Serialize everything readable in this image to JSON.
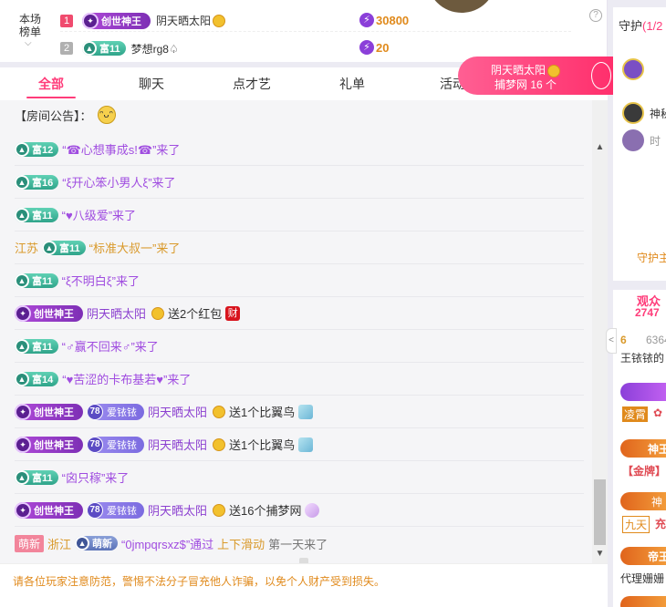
{
  "rank": {
    "label_line1": "本场",
    "label_line2": "榜单",
    "rows": [
      {
        "num": "1",
        "badge": "创世神王",
        "name": "阴天晒太阳",
        "score": "30800",
        "num_color": "#f04b6e"
      },
      {
        "num": "2",
        "badge": "富11",
        "name": "梦想rg8",
        "score": "20",
        "num_color": "#b0b0b0"
      }
    ],
    "help": "?"
  },
  "toast": {
    "name": "阴天晒太阳",
    "line2": "捕梦网 16 个"
  },
  "tabs": [
    "全部",
    "聊天",
    "点才艺",
    "礼单",
    "活动"
  ],
  "notice": {
    "label": "【房间公告】："
  },
  "messages": [
    {
      "badge": "富12",
      "text": "“☎心想事成s!☎”来了"
    },
    {
      "badge": "富16",
      "text": "“ξ开心笨小男人ξ”来了"
    },
    {
      "badge": "富11",
      "text": "“♥八级爱”来了"
    },
    {
      "region": "江苏",
      "badge": "富11",
      "text": "“标准大叔一”来了"
    },
    {
      "badge": "富11",
      "text": "“ξ不明白ξ”来了"
    },
    {
      "vip": "创世神王",
      "user": "阴天晒太阳",
      "action": "送2个红包",
      "gift": "财"
    },
    {
      "badge": "富11",
      "text": "“♂赢不回来♂”来了"
    },
    {
      "badge": "富14",
      "text": "“♥苦涩的卡布基若♥”来了"
    },
    {
      "vip": "创世神王",
      "fan_level": "78",
      "fan_name": "爱铱铱",
      "user": "阴天晒太阳",
      "action": "送1个比翼鸟"
    },
    {
      "vip": "创世神王",
      "fan_level": "78",
      "fan_name": "爱铱铱",
      "user": "阴天晒太阳",
      "action": "送1个比翼鸟"
    },
    {
      "badge": "富11",
      "text": "“囟只稼”来了"
    },
    {
      "vip": "创世神王",
      "fan_level": "78",
      "fan_name": "爱铱铱",
      "user": "阴天晒太阳",
      "action": "送16个捕梦网"
    },
    {
      "tag": "萌新",
      "region": "浙江",
      "badge": "萌新",
      "text": "“0jmpqrsxz$”通过",
      "link": "上下滑动",
      "suffix": "第一天来了"
    }
  ],
  "warning": "请各位玩家注意防范，警惕不法分子冒充他人诈骗，以免个人财产受到损失。",
  "side": {
    "guard_title": "守护",
    "guard_count": "(1/2",
    "guard_items": [
      "神秘",
      "时"
    ],
    "guard_foot": "守护主",
    "audience_label": "观众",
    "audience_count": "2747",
    "top_user": "王铱铱的",
    "top_rank": "6",
    "top_score": "6364",
    "tags": [
      "凌霄",
      "神王",
      "【金牌】",
      "神",
      "九天",
      "充",
      "帝王",
      "代理姗姗"
    ]
  },
  "colors": {
    "accent": "#ff3c7a",
    "wealth": "#2fa48a",
    "vip": "#8b3fd9",
    "warn": "#e08a1c"
  }
}
